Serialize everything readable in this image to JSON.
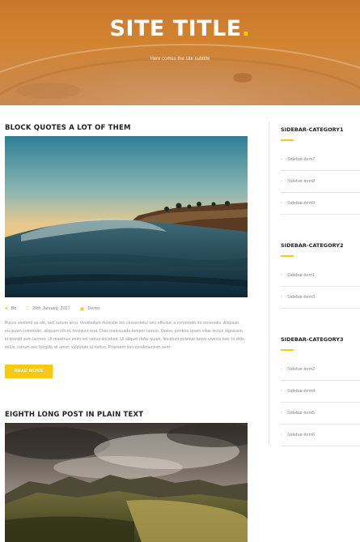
{
  "colors": {
    "accent": "#f5c916",
    "header": "#cc7c33",
    "text_dark": "#222222",
    "text_muted": "#9a9a9a"
  },
  "header": {
    "site_title": "SITE TITLE",
    "title_dot": ".",
    "subtitle": "Here comes the site subtitle"
  },
  "posts": [
    {
      "title": "BLOCK QUOTES A LOT OF THEM",
      "meta": {
        "author_icon": "user-icon",
        "author": "Bb",
        "date_icon": "calendar-icon",
        "date": "29th January, 2017",
        "category_icon": "folder-icon",
        "category": "Demo"
      },
      "excerpt": "Fusce eleifend as elit, sed rutrum arcu. Vestibulum molestie leo consectetur orci efficitur, a commodo mi venenatis. Aliquam eu quam commodo, aliquam elit et, tincidunt erat. Duis malesuada tempor rutrum. Donec porttitor quam vitae lectus dignissim, id blandit sem laoreet. Ut maximus enim vel varius tincidunt. Ut aliquet dolor quam, tincidunt pulvinar turpis viverra nec. In odio tellus, rutrum nec fringilla sit amet, vulputate id metus. Praesent non condimentum sem.",
      "read_more": "READ MORE"
    },
    {
      "title": "EIGHTH LONG POST IN PLAIN TEXT"
    }
  ],
  "sidebar": [
    {
      "title": "SIDEBAR-CATEGORY1",
      "items": [
        "Sidebar-item7",
        "Sidebar-item8",
        "Sidebar-item9"
      ]
    },
    {
      "title": "SIDEBAR-CATEGORY2",
      "items": [
        "Sidebar-item1",
        "Sidebar-item3"
      ]
    },
    {
      "title": "SIDEBAR-CATEGORY3",
      "items": [
        "Sidebar-item2",
        "Sidebar-item4",
        "Sidebar-item5",
        "Sidebar-item6"
      ]
    }
  ]
}
